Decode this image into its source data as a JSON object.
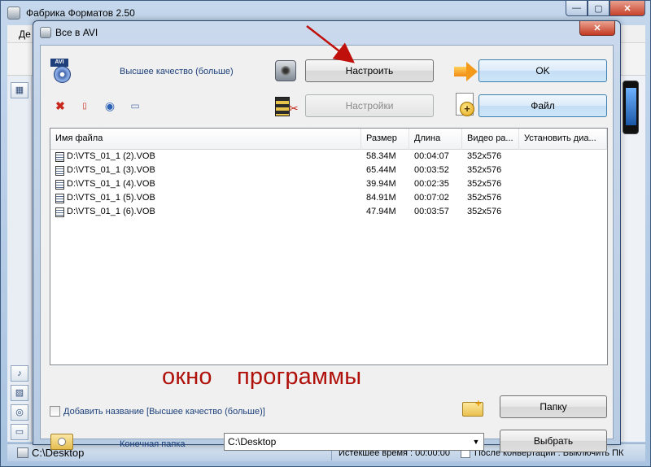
{
  "main_window": {
    "title": "Фабрика Форматов 2.50",
    "menu_first": "Де",
    "controls": {
      "minimize": "—",
      "maximize": "▢",
      "close": "✕"
    }
  },
  "dialog": {
    "title": "Все в AVI",
    "close": "✕",
    "quality_text": "Высшее качество (больше)",
    "buttons": {
      "configure": "Настроить",
      "ok": "OK",
      "settings": "Настройки",
      "file": "Файл",
      "folder": "Папку",
      "browse": "Выбрать"
    },
    "table": {
      "columns": [
        "Имя файла",
        "Размер",
        "Длина",
        "Видео ра...",
        "Установить диа..."
      ],
      "rows": [
        [
          "D:\\VTS_01_1 (2).VOB",
          "58.34M",
          "00:04:07",
          "352x576",
          ""
        ],
        [
          "D:\\VTS_01_1 (3).VOB",
          "65.44M",
          "00:03:52",
          "352x576",
          ""
        ],
        [
          "D:\\VTS_01_1 (4).VOB",
          "39.94M",
          "00:02:35",
          "352x576",
          ""
        ],
        [
          "D:\\VTS_01_1 (5).VOB",
          "84.91M",
          "00:07:02",
          "352x576",
          ""
        ],
        [
          "D:\\VTS_01_1 (6).VOB",
          "47.94M",
          "00:03:57",
          "352x576",
          ""
        ]
      ]
    },
    "annotation": "окно программы",
    "add_name_label": "Добавить название [Высшее качество (больше)]",
    "add_name_checked": false,
    "dest_label": "Конечная папка",
    "dest_value": "C:\\Desktop"
  },
  "status": {
    "path": "C:\\Desktop",
    "elapsed": "Истекшее время : 00:00:00",
    "after_conversion": "После конвертации : Выключить ПК"
  },
  "colors": {
    "accent_text": "#1b3f7a",
    "annotation": "#b0100a",
    "arrow": "#c0100c"
  }
}
